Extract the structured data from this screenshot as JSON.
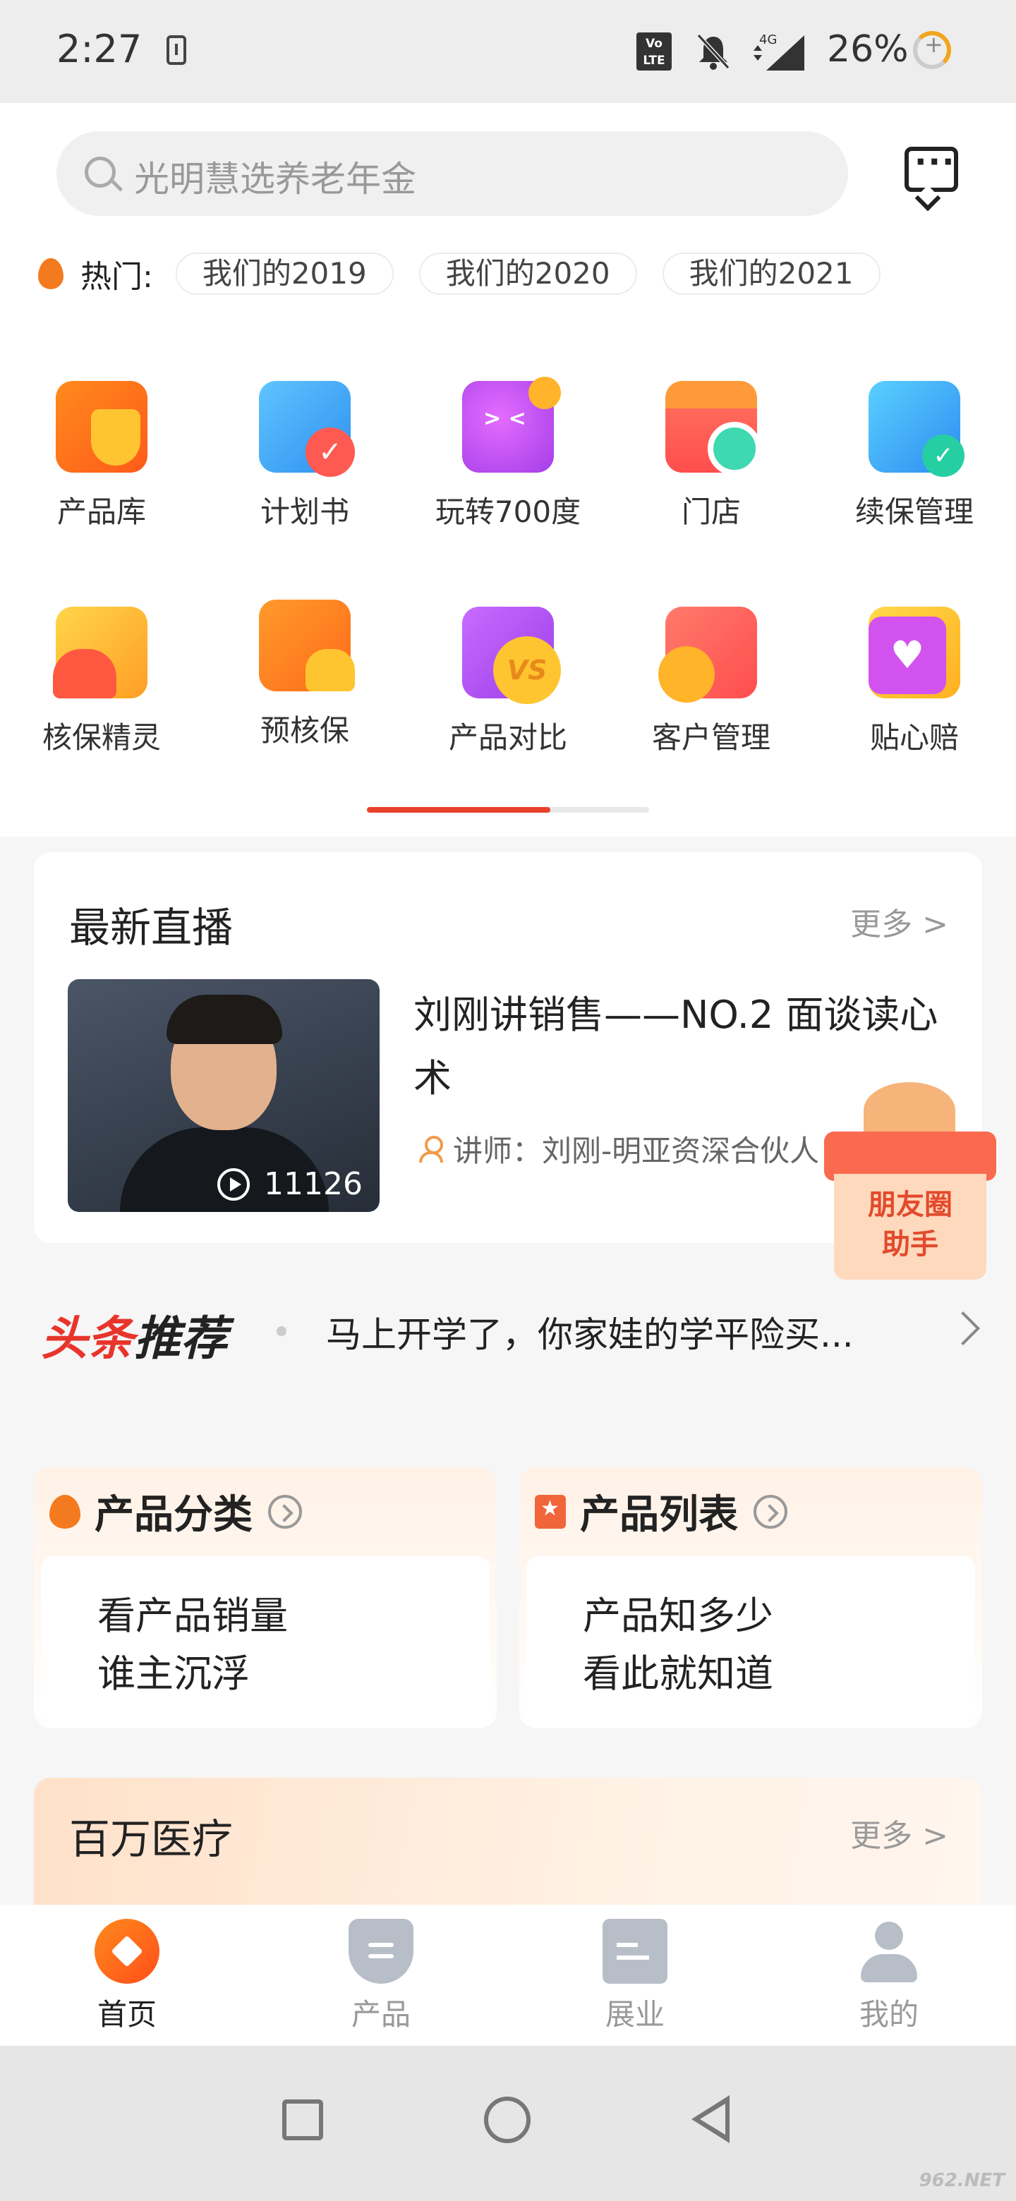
{
  "status_bar": {
    "time": "2:27",
    "battery": "26%",
    "volte": "Vo LTE",
    "network": "4G"
  },
  "search": {
    "placeholder": "光明慧选养老年金"
  },
  "hot": {
    "label": "热门:",
    "tags": [
      "我们的2019",
      "我们的2020",
      "我们的2021"
    ]
  },
  "shortcuts": [
    {
      "label": "产品库",
      "icon": "product-library-icon"
    },
    {
      "label": "计划书",
      "icon": "proposal-icon"
    },
    {
      "label": "玩转700度",
      "icon": "play-700-icon"
    },
    {
      "label": "门店",
      "icon": "store-icon"
    },
    {
      "label": "续保管理",
      "icon": "renewal-icon"
    },
    {
      "label": "核保精灵",
      "icon": "underwriting-icon"
    },
    {
      "label": "预核保",
      "icon": "pre-underwriting-icon"
    },
    {
      "label": "产品对比",
      "icon": "compare-icon"
    },
    {
      "label": "客户管理",
      "icon": "customer-icon"
    },
    {
      "label": "贴心赔",
      "icon": "claims-icon"
    }
  ],
  "live": {
    "title": "最新直播",
    "more": "更多 >",
    "video_title": "刘刚讲销售——NO.2 面谈读心术",
    "views": "11126",
    "teacher": "讲师：刘刚-明亚资深合伙人"
  },
  "gift": {
    "line1": "朋友圈",
    "line2": "助手"
  },
  "headline": {
    "logo_red": "头条",
    "logo_dark": "推荐",
    "text": "马上开学了，你家娃的学平险买..."
  },
  "categories": [
    {
      "title": "产品分类",
      "line1": "看产品销量",
      "line2": "谁主沉浮"
    },
    {
      "title": "产品列表",
      "line1": "产品知多少",
      "line2": "看此就知道"
    }
  ],
  "medical": {
    "title": "百万医疗",
    "more": "更多 >"
  },
  "tabs": [
    {
      "label": "首页"
    },
    {
      "label": "产品"
    },
    {
      "label": "展业"
    },
    {
      "label": "我的"
    }
  ],
  "watermark": "962.NET"
}
